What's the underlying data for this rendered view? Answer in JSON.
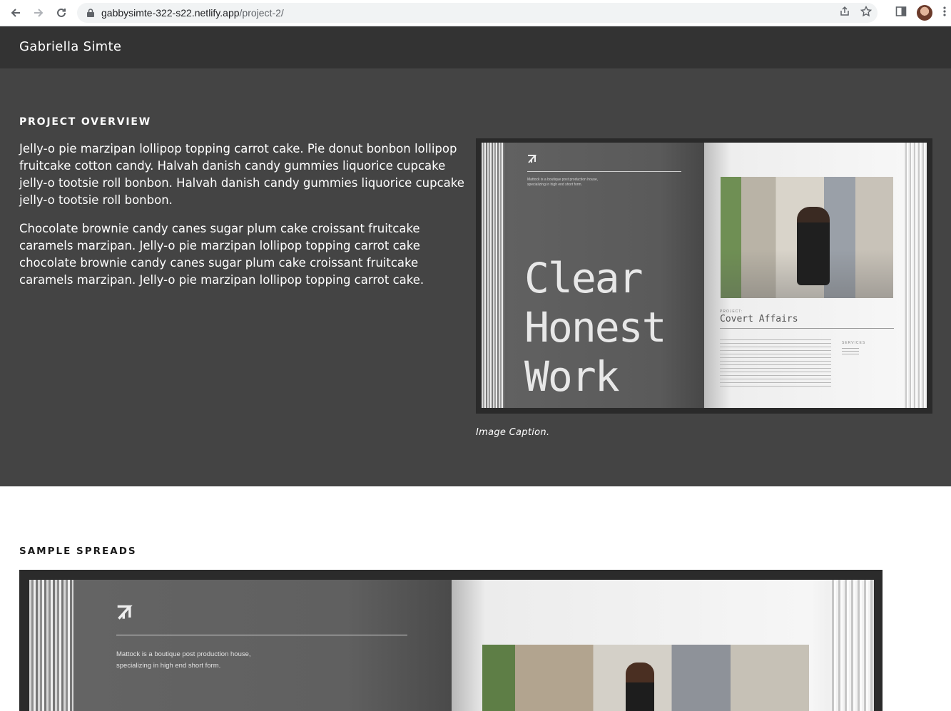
{
  "browser": {
    "url_host": "gabbysimte-322-s22.netlify.app",
    "url_path": "/project-2/"
  },
  "site": {
    "title": "Gabriella Simte"
  },
  "overview": {
    "heading": "PROJECT OVERVIEW",
    "paragraphs": [
      "Jelly-o pie marzipan lollipop topping carrot cake. Pie donut bonbon lollipop fruitcake cotton candy. Halvah danish candy gummies liquorice cupcake jelly-o tootsie roll bonbon. Halvah danish candy gummies liquorice cupcake jelly-o tootsie roll bonbon.",
      "Chocolate brownie candy canes sugar plum cake croissant fruitcake caramels marzipan. Jelly-o pie marzipan lollipop topping carrot cake chocolate brownie candy canes sugar plum cake croissant fruitcake caramels marzipan. Jelly-o pie marzipan lollipop topping carrot cake."
    ],
    "image": {
      "big_text": "Clear\nHonest\nWork",
      "small_text": "Mattock is a boutique post production house, specializing in high end short form.",
      "project_label": "PROJECT:",
      "project_name": "Covert Affairs",
      "services_label": "SERVICES"
    },
    "caption": "Image Caption."
  },
  "samples": {
    "heading": "SAMPLE SPREADS",
    "spread_text_line1": "Mattock is a boutique post production house,",
    "spread_text_line2": "specializing in high end short form."
  }
}
